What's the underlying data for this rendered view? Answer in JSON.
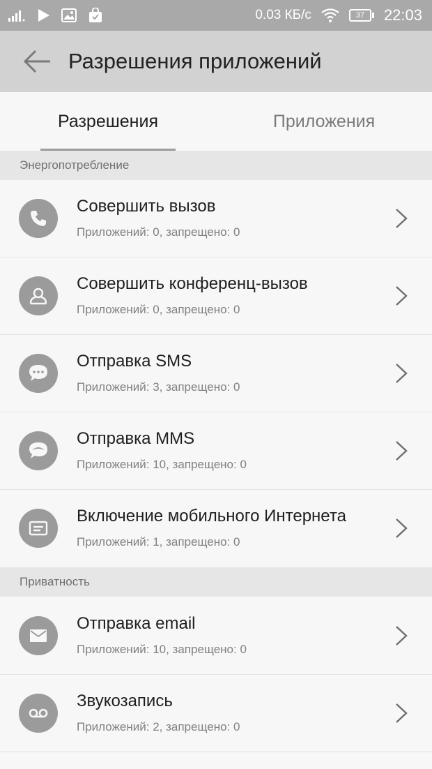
{
  "status_bar": {
    "speed": "0.03 КБ/с",
    "battery": "37",
    "time": "22:03"
  },
  "app_bar": {
    "title": "Разрешения приложений",
    "back_icon": "arrow-left-icon"
  },
  "tabs": [
    {
      "label": "Разрешения",
      "active": true
    },
    {
      "label": "Приложения",
      "active": false
    }
  ],
  "sections": [
    {
      "header": "Энергопотребление",
      "items": [
        {
          "title": "Совершить вызов",
          "subtitle": "Приложений: 0, запрещено: 0",
          "icon": "phone-icon"
        },
        {
          "title": "Совершить конференц-вызов",
          "subtitle": "Приложений: 0, запрещено: 0",
          "icon": "group-call-icon"
        },
        {
          "title": "Отправка SMS",
          "subtitle": "Приложений: 3, запрещено: 0",
          "icon": "sms-icon"
        },
        {
          "title": "Отправка MMS",
          "subtitle": "Приложений: 10, запрещено: 0",
          "icon": "mms-icon"
        },
        {
          "title": "Включение мобильного Интернета",
          "subtitle": "Приложений: 1, запрещено: 0",
          "icon": "mobile-data-icon"
        }
      ]
    },
    {
      "header": "Приватность",
      "items": [
        {
          "title": "Отправка email",
          "subtitle": "Приложений: 10, запрещено: 0",
          "icon": "email-icon"
        },
        {
          "title": "Звукозапись",
          "subtitle": "Приложений: 2, запрещено: 0",
          "icon": "voicemail-icon"
        }
      ]
    }
  ],
  "colors": {
    "status_bar": "#a9a9a9",
    "app_bar": "#d2d2d2",
    "background": "#f7f7f7",
    "section_header": "#e6e6e6",
    "icon_circle": "#9b9b9b"
  }
}
